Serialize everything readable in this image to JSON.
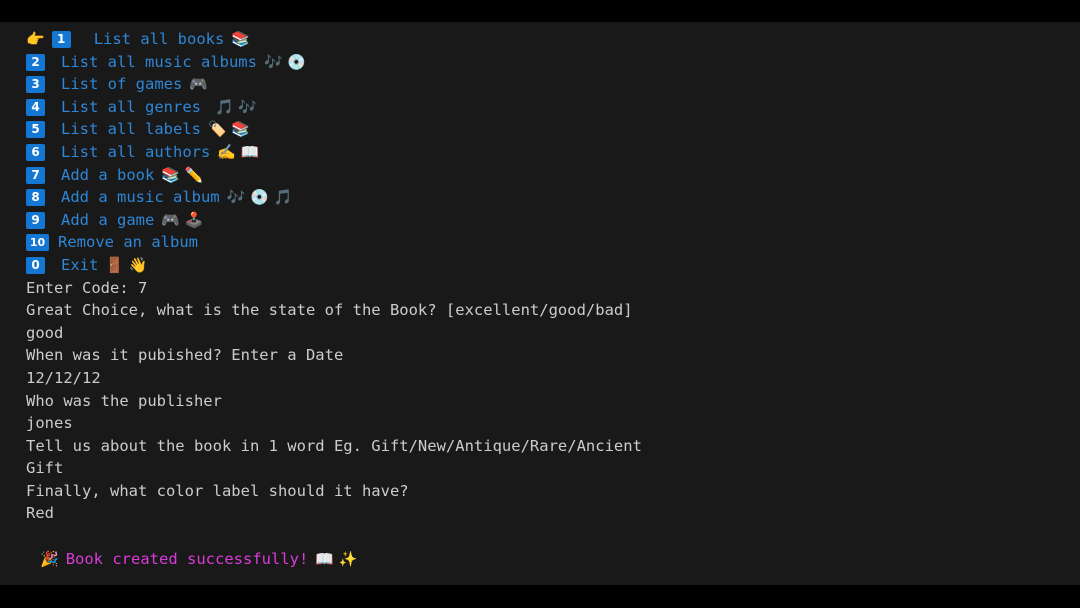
{
  "window": {
    "background_color": "#191919",
    "letterbox_color": "#000000",
    "text_color": "#cccccc",
    "menu_color": "#2e86d6",
    "badge_color": "#1477d4",
    "success_color": "#d93ad9"
  },
  "menu": {
    "cursor_icon": "👉",
    "items": [
      {
        "code": "1",
        "label": "List all books",
        "icons": "📚",
        "selected": true
      },
      {
        "code": "2",
        "label": "List all music albums",
        "icons": "🎶 💿",
        "selected": false
      },
      {
        "code": "3",
        "label": "List of games",
        "icons": "🎮",
        "selected": false
      },
      {
        "code": "4",
        "label": "List all genres",
        "icons": "🎵 🎶",
        "selected": false
      },
      {
        "code": "5",
        "label": "List all labels",
        "icons": "🏷️ 📚",
        "selected": false
      },
      {
        "code": "6",
        "label": "List all authors",
        "icons": "✍️ 📖",
        "selected": false
      },
      {
        "code": "7",
        "label": "Add a book",
        "icons": "📚 ✏️",
        "selected": false
      },
      {
        "code": "8",
        "label": "Add a music album",
        "icons": "🎶 💿 🎵",
        "selected": false
      },
      {
        "code": "9",
        "label": "Add a game",
        "icons": "🎮 🕹️",
        "selected": false
      },
      {
        "code": "10",
        "label": "Remove an album",
        "icons": "",
        "selected": false
      },
      {
        "code": "0",
        "label": "Exit",
        "icons": "🚪 👋",
        "selected": false
      }
    ]
  },
  "session": {
    "lines": [
      {
        "kind": "prompt",
        "text": "Enter Code: 7"
      },
      {
        "kind": "prompt",
        "text": "Great Choice, what is the state of the Book? [excellent/good/bad]"
      },
      {
        "kind": "input",
        "text": "good"
      },
      {
        "kind": "prompt",
        "text": "When was it pubished? Enter a Date"
      },
      {
        "kind": "input",
        "text": "12/12/12"
      },
      {
        "kind": "prompt",
        "text": "Who was the publisher"
      },
      {
        "kind": "input",
        "text": "jones"
      },
      {
        "kind": "prompt",
        "text": "Tell us about the book in 1 word Eg. Gift/New/Antique/Rare/Ancient"
      },
      {
        "kind": "input",
        "text": "Gift"
      },
      {
        "kind": "prompt",
        "text": "Finally, what color label should it have?"
      },
      {
        "kind": "input",
        "text": "Red"
      }
    ]
  },
  "result": {
    "lead_icon": "🎉",
    "message": "Book created successfully!",
    "trail_icons": "📖 ✨"
  }
}
